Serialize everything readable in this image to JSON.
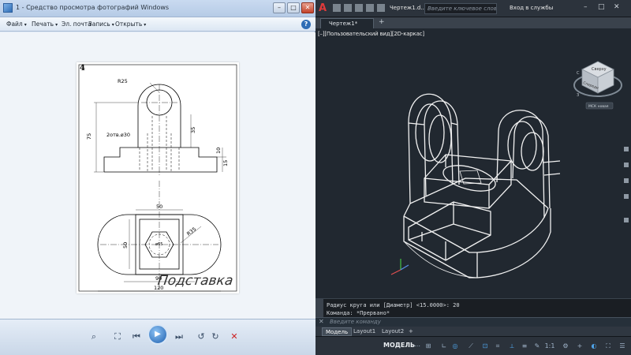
{
  "viewer": {
    "title": "1 - Средство просмотра фотографий Windows",
    "menu": [
      "Файл",
      "Печать",
      "Эл. почта",
      "Запись",
      "Открыть"
    ],
    "help_icon": "question-mark-icon",
    "sheet": {
      "number": "4",
      "name": "Подставка",
      "dims": {
        "r25": "R25",
        "hole": "2отв.ø30",
        "d75": "75",
        "d35": "35",
        "d10": "10",
        "d15": "15",
        "d50_top": "50",
        "d50_side": "50",
        "d65": "ø65",
        "r35": "R35",
        "d90": "90",
        "d120": "120"
      }
    }
  },
  "acad": {
    "doc_title": "Чертеж1.d...",
    "search_placeholder": "Введите ключевое слово/фразу",
    "signin": "Вход в службы",
    "tab": "Чертеж1*",
    "viewport_label": "[–][Пользовательский вид][2D-каркас]",
    "viewcube": {
      "face_top": "Сверху",
      "face_left": "Спереди",
      "wcs": "МСК новая"
    },
    "command_lines": [
      "Радиус круга или [Диаметр] <15.0000>: 20",
      "Команда: *Прервано*"
    ],
    "command_prompt": "Введите команду",
    "layouts": [
      "Модель",
      "Layout1",
      "Layout2"
    ],
    "status_model": "МОДЕЛЬ",
    "scale": "1:1"
  }
}
